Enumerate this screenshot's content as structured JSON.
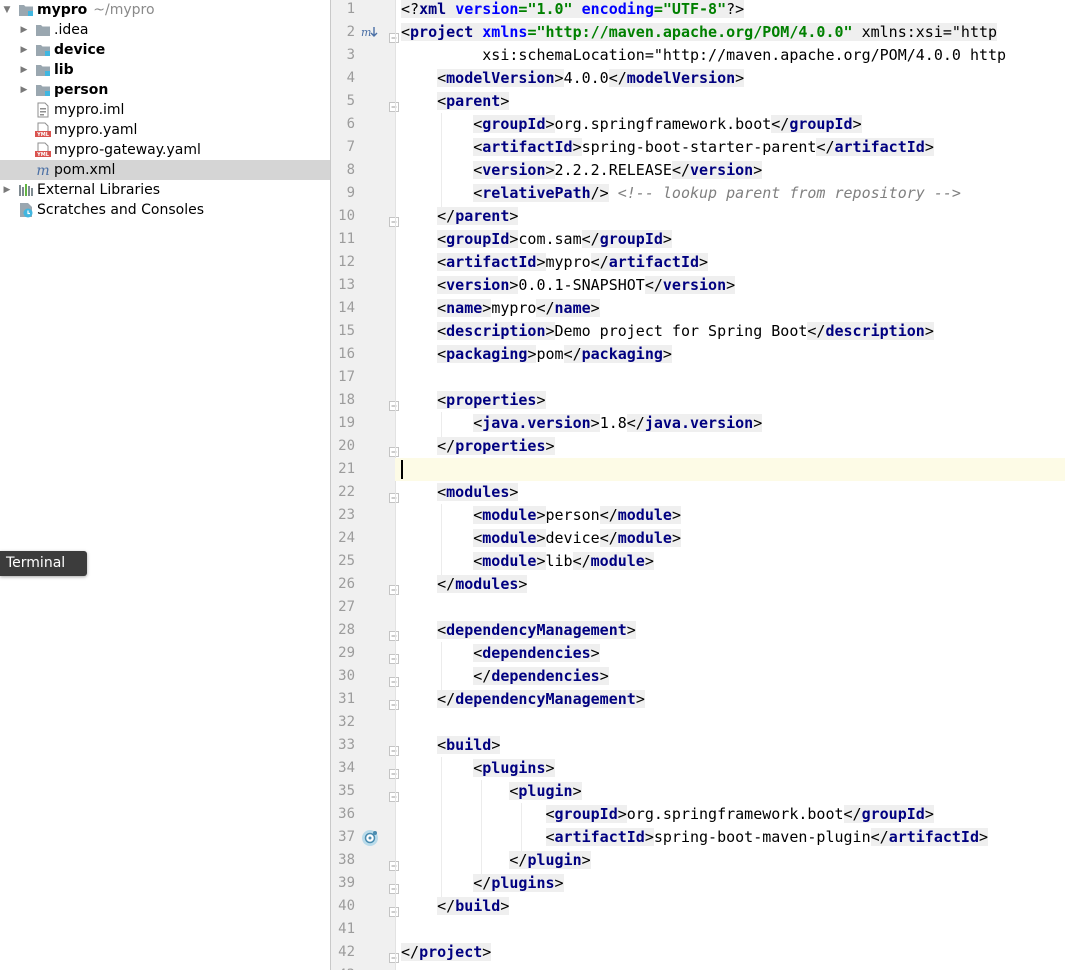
{
  "project_tree": {
    "root": {
      "name": "mypro",
      "path": "~/mypro"
    },
    "items": [
      {
        "label": "mypro",
        "hint": "~/mypro",
        "type": "module-folder",
        "bold": true,
        "arrow": "expanded",
        "indent": 0
      },
      {
        "label": ".idea",
        "type": "folder",
        "bold": false,
        "arrow": "collapsed",
        "indent": 1
      },
      {
        "label": "device",
        "type": "module-folder",
        "bold": true,
        "arrow": "collapsed",
        "indent": 1
      },
      {
        "label": "lib",
        "type": "module-folder",
        "bold": true,
        "arrow": "collapsed",
        "indent": 1
      },
      {
        "label": "person",
        "type": "module-folder",
        "bold": true,
        "arrow": "collapsed",
        "indent": 1
      },
      {
        "label": "mypro.iml",
        "type": "iml-file",
        "bold": false,
        "arrow": "none",
        "indent": 1
      },
      {
        "label": "mypro.yaml",
        "type": "yaml-file",
        "bold": false,
        "arrow": "none",
        "indent": 1
      },
      {
        "label": "mypro-gateway.yaml",
        "type": "yaml-file",
        "bold": false,
        "arrow": "none",
        "indent": 1
      },
      {
        "label": "pom.xml",
        "type": "maven-file",
        "bold": false,
        "arrow": "none",
        "indent": 1,
        "selected": true
      },
      {
        "label": "External Libraries",
        "type": "libraries",
        "bold": false,
        "arrow": "collapsed",
        "indent": 0
      },
      {
        "label": "Scratches and Consoles",
        "type": "scratches",
        "bold": false,
        "arrow": "none",
        "indent": 0
      }
    ]
  },
  "tooltip": {
    "label": "Terminal"
  },
  "editor": {
    "file": "pom.xml",
    "current_line": 21,
    "lines": [
      "<?xml version=\"1.0\" encoding=\"UTF-8\"?>",
      "<project xmlns=\"http://maven.apache.org/POM/4.0.0\" xmlns:xsi=\"http",
      "         xsi:schemaLocation=\"http://maven.apache.org/POM/4.0.0 http",
      "    <modelVersion>4.0.0</modelVersion>",
      "    <parent>",
      "        <groupId>org.springframework.boot</groupId>",
      "        <artifactId>spring-boot-starter-parent</artifactId>",
      "        <version>2.2.2.RELEASE</version>",
      "        <relativePath/> <!-- lookup parent from repository -->",
      "    </parent>",
      "    <groupId>com.sam</groupId>",
      "    <artifactId>mypro</artifactId>",
      "    <version>0.0.1-SNAPSHOT</version>",
      "    <name>mypro</name>",
      "    <description>Demo project for Spring Boot</description>",
      "    <packaging>pom</packaging>",
      "",
      "    <properties>",
      "        <java.version>1.8</java.version>",
      "    </properties>",
      "",
      "    <modules>",
      "        <module>person</module>",
      "        <module>device</module>",
      "        <module>lib</module>",
      "    </modules>",
      "",
      "    <dependencyManagement>",
      "        <dependencies>",
      "        </dependencies>",
      "    </dependencyManagement>",
      "",
      "    <build>",
      "        <plugins>",
      "            <plugin>",
      "                <groupId>org.springframework.boot</groupId>",
      "                <artifactId>spring-boot-maven-plugin</artifactId>",
      "            </plugin>",
      "        </plugins>",
      "    </build>",
      "",
      "</project>",
      ""
    ],
    "fold_lines": [
      2,
      5,
      10,
      18,
      20,
      22,
      26,
      28,
      29,
      30,
      31,
      33,
      34,
      35,
      38,
      39,
      40,
      42
    ],
    "gutter_icons": [
      {
        "line": 2,
        "icon": "maven-navigate-icon"
      },
      {
        "line": 37,
        "icon": "maven-plugin-icon"
      }
    ]
  }
}
